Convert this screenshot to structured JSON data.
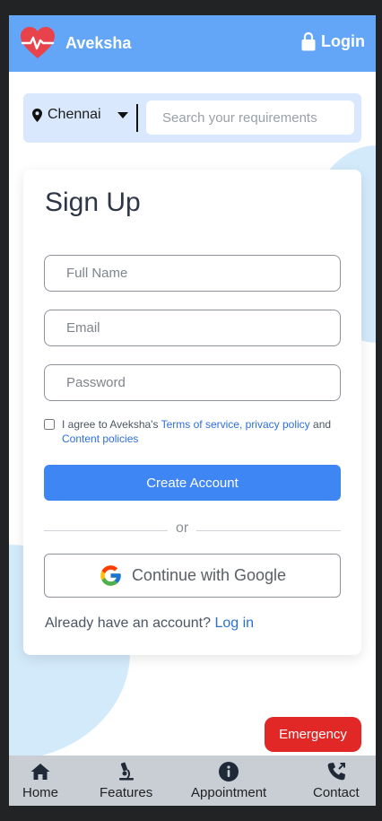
{
  "header": {
    "app_title": "Aveksha",
    "login_label": "Login"
  },
  "search": {
    "city": "Chennai",
    "placeholder": "Search your requirements"
  },
  "signup": {
    "title": "Sign Up",
    "full_name_placeholder": "Full Name",
    "email_placeholder": "Email",
    "password_placeholder": "Password",
    "agree_prefix": "I agree to Aveksha's",
    "terms_link": "Terms of service,",
    "privacy_link": "privacy policy",
    "and_text": "and",
    "content_link": "Content policies",
    "create_button": "Create Account",
    "or_text": "or",
    "google_button": "Continue with Google",
    "already_text": "Already have an account?",
    "login_link": "Log in"
  },
  "emergency_label": "Emergency",
  "bottom_nav": [
    {
      "label": "Home",
      "icon": "home-icon"
    },
    {
      "label": "Features",
      "icon": "microscope-icon"
    },
    {
      "label": "Appointment",
      "icon": "info-icon"
    },
    {
      "label": "Contact",
      "icon": "phone-icon"
    }
  ],
  "colors": {
    "header_bg": "#63a6f8",
    "primary": "#3d86f3",
    "emergency": "#e22727",
    "link": "#2c6fd8",
    "logo_red": "#e8424a"
  }
}
